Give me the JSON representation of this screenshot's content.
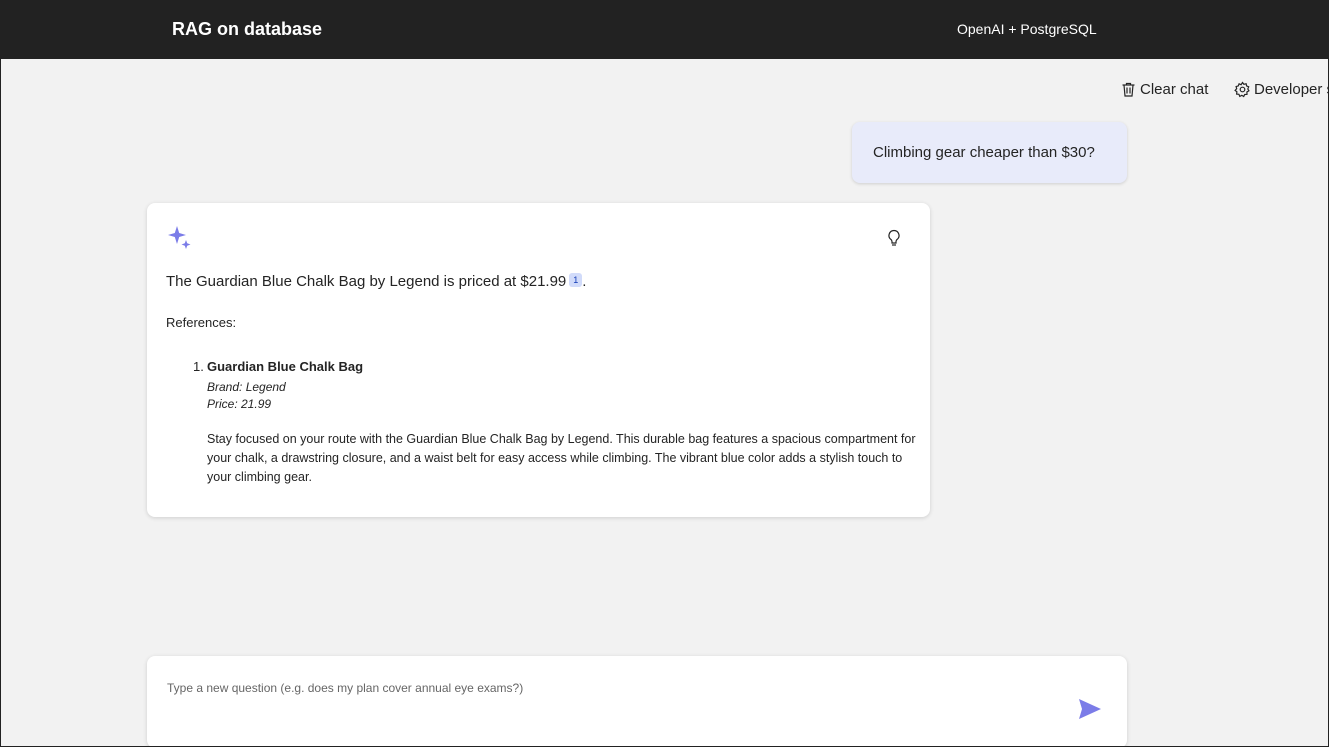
{
  "header": {
    "title": "RAG on database",
    "provider": "OpenAI + PostgreSQL"
  },
  "commands": {
    "clear_chat": "Clear chat",
    "developer": "Developer settings"
  },
  "conversation": {
    "user_question": "Climbing gear cheaper than $30?",
    "answer": {
      "text": "The Guardian Blue Chalk Bag by Legend is priced at $21.99",
      "citation_number": "1",
      "trailing": ".",
      "references_label": "References:",
      "references": [
        {
          "number": "1.",
          "title": "Guardian Blue Chalk Bag",
          "brand": "Brand: Legend",
          "price": "Price: 21.99",
          "description": "Stay focused on your route with the Guardian Blue Chalk Bag by Legend. This durable bag features a spacious compartment for your chalk, a drawstring closure, and a waist belt for easy access while climbing. The vibrant blue color adds a stylish touch to your climbing gear."
        }
      ]
    }
  },
  "question_input": {
    "placeholder": "Type a new question (e.g. does my plan cover annual eye exams?)",
    "value": ""
  },
  "icons": {
    "clear": "trash-icon",
    "developer": "gear-icon",
    "answer": "sparkle-icon",
    "thought": "lightbulb-icon",
    "send": "send-icon"
  },
  "colors": {
    "header_bg": "#222222",
    "user_bubble": "#e8ebfa",
    "accent": "#7b7ce8",
    "citation_bg": "#d1dbfa"
  }
}
